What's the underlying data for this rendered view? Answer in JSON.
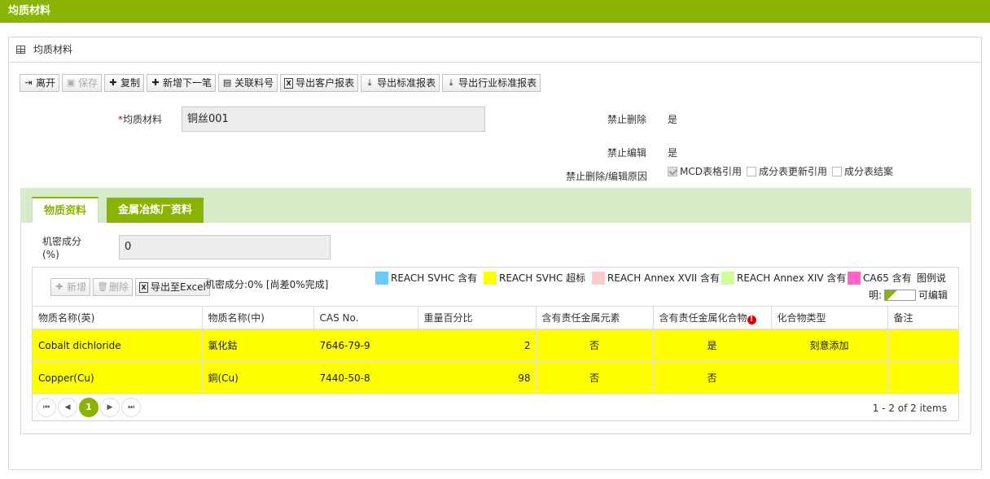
{
  "topbar": {
    "title": "均质材料"
  },
  "panel": {
    "title": "均质材料"
  },
  "toolbar": {
    "leave": "离开",
    "save": "保存",
    "copy": "复制",
    "add_next": "新增下一笔",
    "link_part": "关联料号",
    "export_customer": "导出客户报表",
    "export_standard": "导出标准报表",
    "export_industry": "导出行业标准报表"
  },
  "form": {
    "material_label": "均质材料",
    "material_required_mark": "*",
    "material_value": "铜丝001",
    "forbid_delete_label": "禁止删除",
    "forbid_delete_value": "是",
    "forbid_edit_label": "禁止编辑",
    "forbid_edit_value": "是",
    "reason_label": "禁止删除/编辑原因",
    "reasons": [
      {
        "label": "MCD表格引用",
        "checked": true
      },
      {
        "label": "成分表更新引用",
        "checked": false
      },
      {
        "label": "成分表结案",
        "checked": false
      }
    ]
  },
  "tabs": [
    {
      "label": "物质资料",
      "active": true
    },
    {
      "label": "金属冶炼厂资料",
      "active": false
    }
  ],
  "substance": {
    "confidential_label_1": "机密成分",
    "confidential_label_2": "(%)",
    "confidential_value": "0",
    "grid_toolbar": {
      "add": "新增",
      "delete": "删除",
      "export_excel": "导出至Excel",
      "status": "机密成分:0% [尚差0%完成]"
    },
    "legend": [
      {
        "label": "REACH SVHC 含有",
        "color": "#66ccff"
      },
      {
        "label": "REACH SVHC 超标",
        "color": "#ffff00"
      },
      {
        "label": "REACH Annex XVII 含有",
        "color": "#ffcccc"
      },
      {
        "label": "REACH Annex XIV 含有",
        "color": "#ccff99"
      },
      {
        "label": "CA65 含有",
        "color": "#ff66cc"
      }
    ],
    "legend_note_1": "图例说",
    "legend_note_2": "明:",
    "editable_label": "可编辑",
    "columns": [
      "物质名称(英)",
      "物质名称(中)",
      "CAS No.",
      "重量百分比",
      "含有责任金属元素",
      "含有责任金属化合物",
      "化合物类型",
      "备注"
    ],
    "rows": [
      {
        "en": "Cobalt dichloride",
        "zh": "氯化鈷",
        "cas": "7646-79-9",
        "weight": "2",
        "metal": "否",
        "compound": "是",
        "type": "刻意添加",
        "note": ""
      },
      {
        "en": "Copper(Cu)",
        "zh": "銅(Cu)",
        "cas": "7440-50-8",
        "weight": "98",
        "metal": "否",
        "compound": "否",
        "type": "",
        "note": ""
      }
    ],
    "pager": {
      "current": "1",
      "info": "1 - 2 of 2 items"
    }
  }
}
